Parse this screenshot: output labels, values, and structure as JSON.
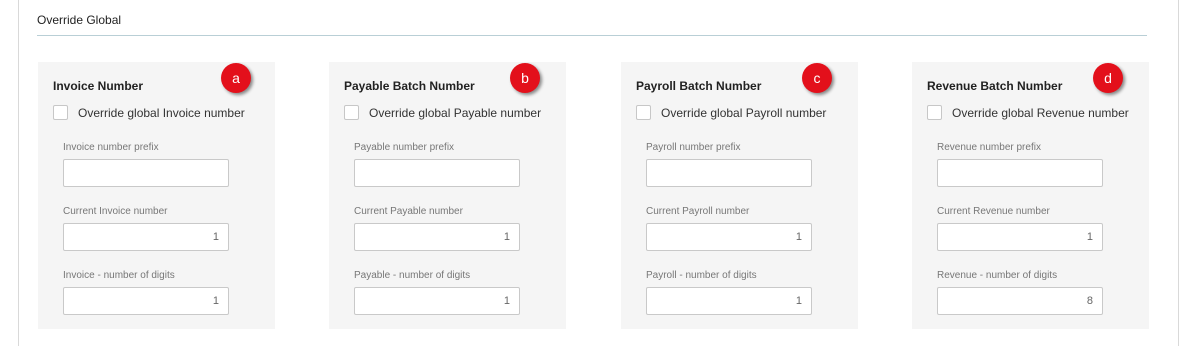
{
  "section": {
    "title": "Override Global"
  },
  "panels": [
    {
      "title": "Invoice Number",
      "badge": "a",
      "override_label": "Override global Invoice number",
      "prefix_label": "Invoice number prefix",
      "prefix_value": "",
      "current_label": "Current Invoice number",
      "current_value": "1",
      "digits_label": "Invoice - number of digits",
      "digits_value": "1"
    },
    {
      "title": "Payable Batch Number",
      "badge": "b",
      "override_label": "Override global Payable number",
      "prefix_label": "Payable number prefix",
      "prefix_value": "",
      "current_label": "Current Payable number",
      "current_value": "1",
      "digits_label": "Payable - number of digits",
      "digits_value": "1"
    },
    {
      "title": "Payroll Batch Number",
      "badge": "c",
      "override_label": "Override global Payroll number",
      "prefix_label": "Payroll number prefix",
      "prefix_value": "",
      "current_label": "Current Payroll number",
      "current_value": "1",
      "digits_label": "Payroll - number of digits",
      "digits_value": "1"
    },
    {
      "title": "Revenue Batch Number",
      "badge": "d",
      "override_label": "Override global Revenue number",
      "prefix_label": "Revenue number prefix",
      "prefix_value": "",
      "current_label": "Current Revenue number",
      "current_value": "1",
      "digits_label": "Revenue - number of digits",
      "digits_value": "8"
    }
  ],
  "colors": {
    "badge": "#e3101b",
    "panel_background": "#f5f5f5",
    "section_rule": "#b9cfd6"
  }
}
